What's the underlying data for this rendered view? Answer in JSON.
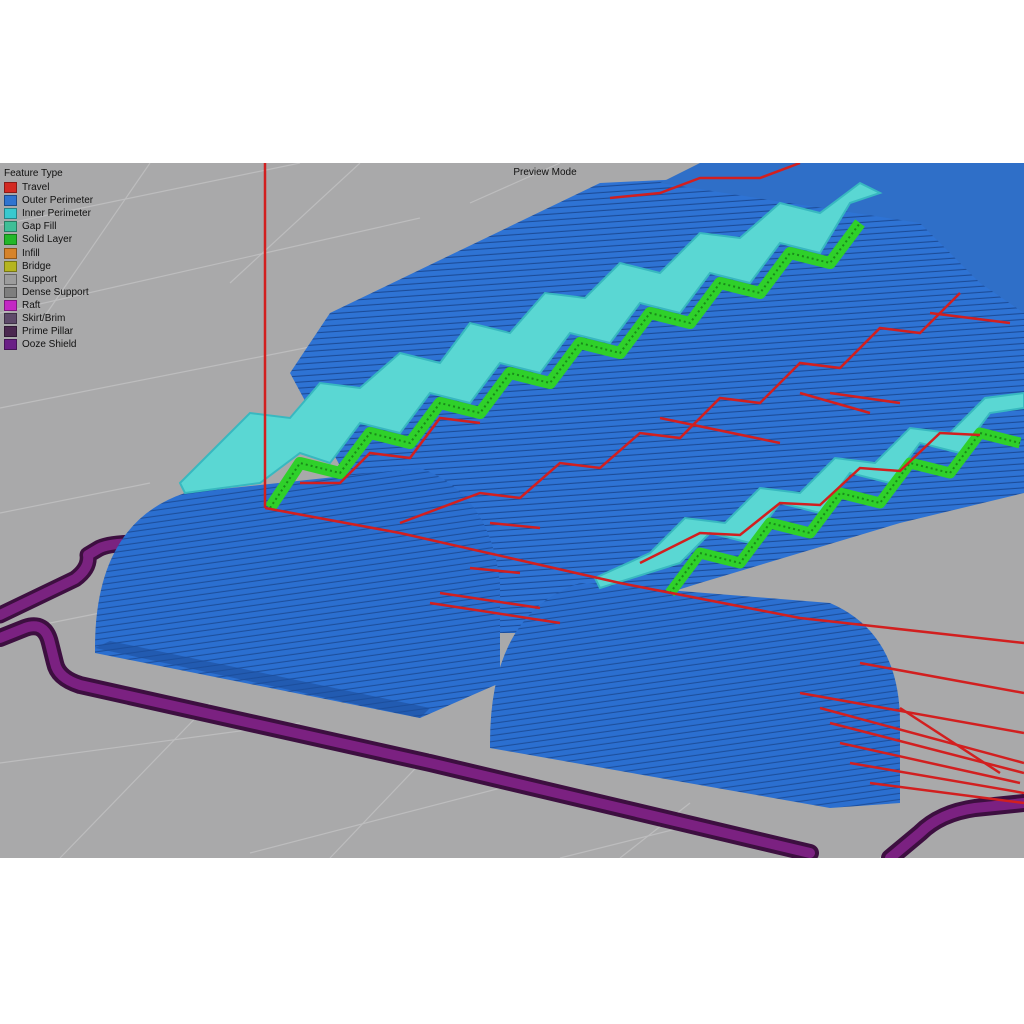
{
  "viewer": {
    "mode_label": "Preview Mode",
    "legend_title": "Feature Type",
    "legend": [
      {
        "label": "Travel",
        "color": "#d42a22"
      },
      {
        "label": "Outer Perimeter",
        "color": "#2f74d0"
      },
      {
        "label": "Inner Perimeter",
        "color": "#39c9cf"
      },
      {
        "label": "Gap Fill",
        "color": "#3fbf97"
      },
      {
        "label": "Solid Layer",
        "color": "#23b82a"
      },
      {
        "label": "Infill",
        "color": "#d6832a"
      },
      {
        "label": "Bridge",
        "color": "#b5b51f"
      },
      {
        "label": "Support",
        "color": "#9c9c9c"
      },
      {
        "label": "Dense Support",
        "color": "#7e7e7e"
      },
      {
        "label": "Raft",
        "color": "#c428c4"
      },
      {
        "label": "Skirt/Brim",
        "color": "#5e4a6a"
      },
      {
        "label": "Prime Pillar",
        "color": "#4b2850"
      },
      {
        "label": "Ooze Shield",
        "color": "#6a1f86"
      }
    ]
  },
  "colors": {
    "background": "#a9a9aa",
    "grid": "#bdbdbe",
    "outer_perimeter": "#2a6fd0",
    "inner_perimeter": "#52d6d2",
    "solid_layer": "#2fd02a",
    "travel": "#d21f1f",
    "skirt": "#6a1b6e"
  }
}
